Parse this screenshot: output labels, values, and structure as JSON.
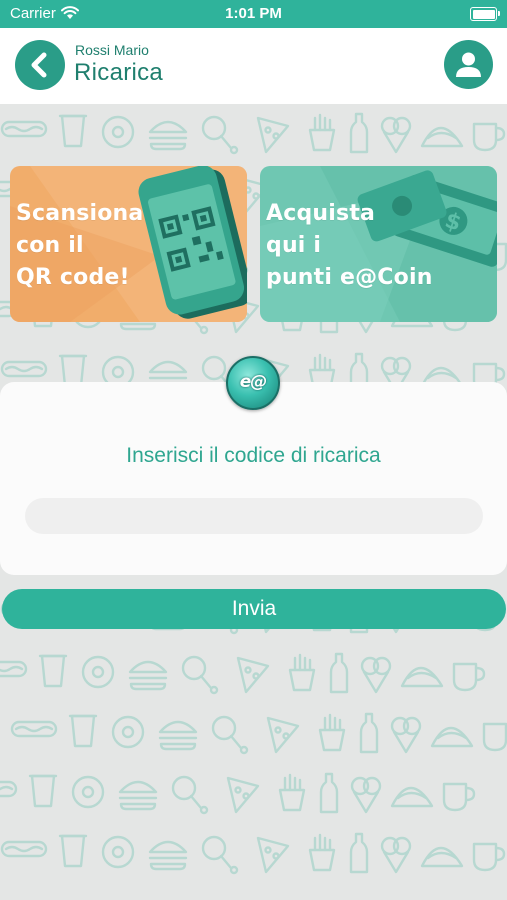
{
  "status_bar": {
    "carrier": "Carrier",
    "time": "1:01 PM",
    "wifi_icon": "wifi-icon",
    "battery_icon": "battery-icon"
  },
  "header": {
    "user_name": "Rossi Mario",
    "title": "Ricarica",
    "back_icon": "chevron-left-icon",
    "profile_icon": "user-icon"
  },
  "promos": [
    {
      "text": "Scansiona\ncon il\nQR code!",
      "icon": "qr-phone-icon",
      "color": "#f1ad6b"
    },
    {
      "text": "Acquista\nqui i\npunti e@Coin",
      "icon": "money-icon",
      "color": "#6fc7b2"
    }
  ],
  "logo": {
    "text": "e@"
  },
  "recharge": {
    "prompt": "Inserisci il codice di ricarica",
    "code_value": "",
    "code_placeholder": ""
  },
  "submit": {
    "label": "Invia"
  },
  "colors": {
    "accent": "#2fb39b",
    "accent_dark": "#2a9d88",
    "title_text": "#1f7f6e",
    "background": "#e4e6e5"
  }
}
